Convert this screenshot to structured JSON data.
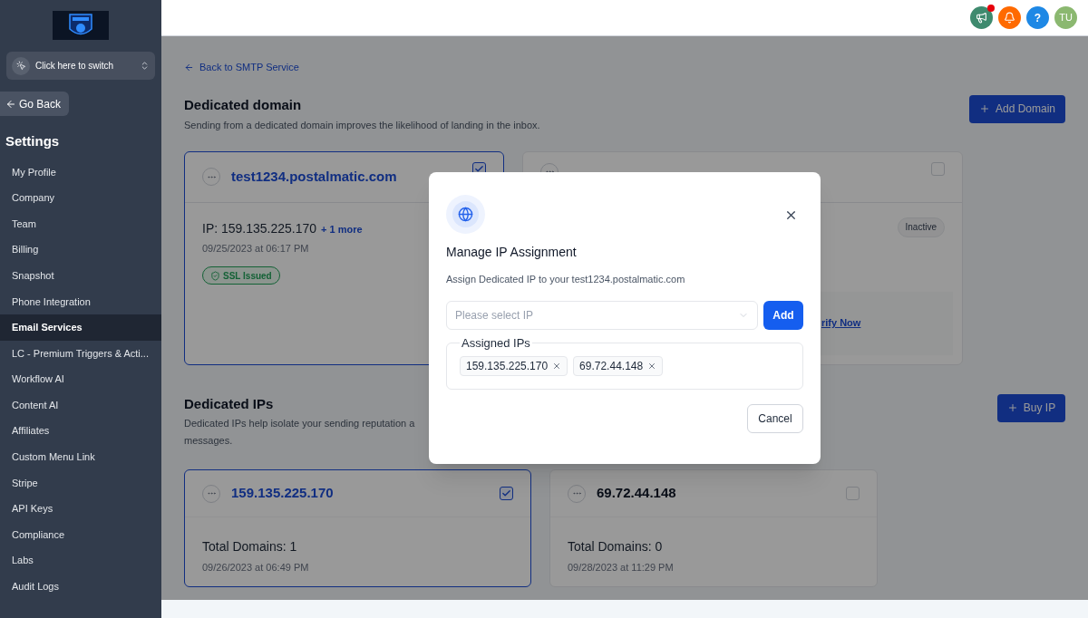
{
  "sidebar": {
    "switcher": {
      "label": "Click here to switch"
    },
    "go_back": "Go Back",
    "heading": "Settings",
    "items": [
      {
        "label": "My Profile",
        "selected": false
      },
      {
        "label": "Company",
        "selected": false
      },
      {
        "label": "Team",
        "selected": false
      },
      {
        "label": "Billing",
        "selected": false
      },
      {
        "label": "Snapshot",
        "selected": false
      },
      {
        "label": "Phone Integration",
        "selected": false
      },
      {
        "label": "Email Services",
        "selected": true
      },
      {
        "label": "LC - Premium Triggers & Acti...",
        "selected": false
      },
      {
        "label": "Workflow AI",
        "selected": false
      },
      {
        "label": "Content AI",
        "selected": false
      },
      {
        "label": "Affiliates",
        "selected": false
      },
      {
        "label": "Custom Menu Link",
        "selected": false
      },
      {
        "label": "Stripe",
        "selected": false
      },
      {
        "label": "API Keys",
        "selected": false
      },
      {
        "label": "Compliance",
        "selected": false
      },
      {
        "label": "Labs",
        "selected": false
      },
      {
        "label": "Audit Logs",
        "selected": false
      }
    ]
  },
  "topbar": {
    "notification_dot": true,
    "help_label": "?",
    "avatar_initials": "TU"
  },
  "back_link": "Back to SMTP Service",
  "dedicated_domain": {
    "title": "Dedicated domain",
    "subtitle": "Sending from a dedicated domain improves the likelihood of landing in the inbox.",
    "add_button": "Add Domain",
    "cards": [
      {
        "kind": "active",
        "selected": true,
        "name": "test1234.postalmatic.com",
        "ip": "IP: 159.135.225.170",
        "more": "+ 1 more",
        "date": "09/25/2023 at 06:17 PM",
        "badge": "SSL Issued"
      },
      {
        "kind": "inactive",
        "selected": false,
        "badge": "Inactive",
        "link": "rify Now"
      }
    ]
  },
  "dedicated_ips": {
    "title": "Dedicated IPs",
    "subtitle_lines": [
      "Dedicated IPs help isolate your sending reputation a",
      "messages."
    ],
    "buy_button": "Buy IP",
    "cards": [
      {
        "selected": true,
        "ip": "159.135.225.170",
        "total": "Total Domains: 1",
        "date": "09/26/2023 at 06:49 PM"
      },
      {
        "selected": false,
        "ip": "69.72.44.148",
        "total": "Total Domains: 0",
        "date": "09/28/2023 at 11:29 PM"
      }
    ]
  },
  "modal": {
    "title": "Manage IP Assignment",
    "description": "Assign Dedicated IP to your test1234.postalmatic.com",
    "select": {
      "placeholder": "Please select IP"
    },
    "add_button": "Add",
    "assigned_legend": "Assigned IPs",
    "assigned": [
      "159.135.225.170",
      "69.72.44.148"
    ],
    "cancel_button": "Cancel"
  }
}
